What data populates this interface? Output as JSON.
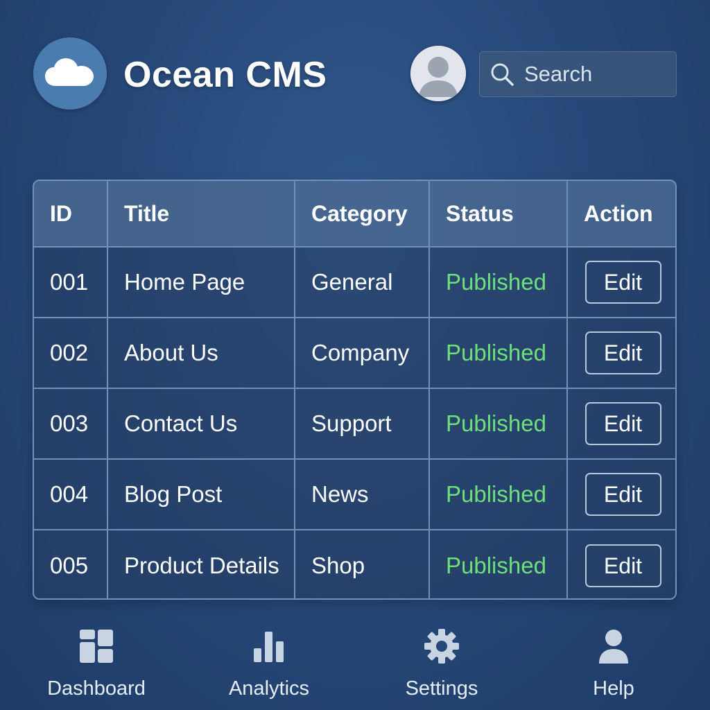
{
  "app": {
    "title": "Ocean CMS",
    "logo_icon": "cloud-icon",
    "avatar_icon": "user-avatar-icon"
  },
  "search": {
    "placeholder": "Search",
    "icon": "search-icon"
  },
  "table": {
    "columns": [
      "ID",
      "Title",
      "Category",
      "Status",
      "Action"
    ],
    "rows": [
      {
        "id": "001",
        "title": "Home Page",
        "category": "General",
        "status": "Published",
        "action": "Edit"
      },
      {
        "id": "002",
        "title": "About Us",
        "category": "Company",
        "status": "Published",
        "action": "Edit"
      },
      {
        "id": "003",
        "title": "Contact Us",
        "category": "Support",
        "status": "Published",
        "action": "Edit"
      },
      {
        "id": "004",
        "title": "Blog Post",
        "category": "News",
        "status": "Published",
        "action": "Edit"
      },
      {
        "id": "005",
        "title": "Product Details",
        "category": "Shop",
        "status": "Published",
        "action": "Edit"
      }
    ]
  },
  "nav": {
    "items": [
      {
        "label": "Dashboard",
        "icon": "dashboard-icon"
      },
      {
        "label": "Analytics",
        "icon": "bar-chart-icon"
      },
      {
        "label": "Settings",
        "icon": "gear-icon"
      },
      {
        "label": "Help",
        "icon": "person-icon"
      }
    ]
  },
  "colors": {
    "background": "#27497a",
    "status_published": "#6ee07a",
    "table_border": "#6f92bd",
    "logo_circle": "#4a7cb0"
  }
}
